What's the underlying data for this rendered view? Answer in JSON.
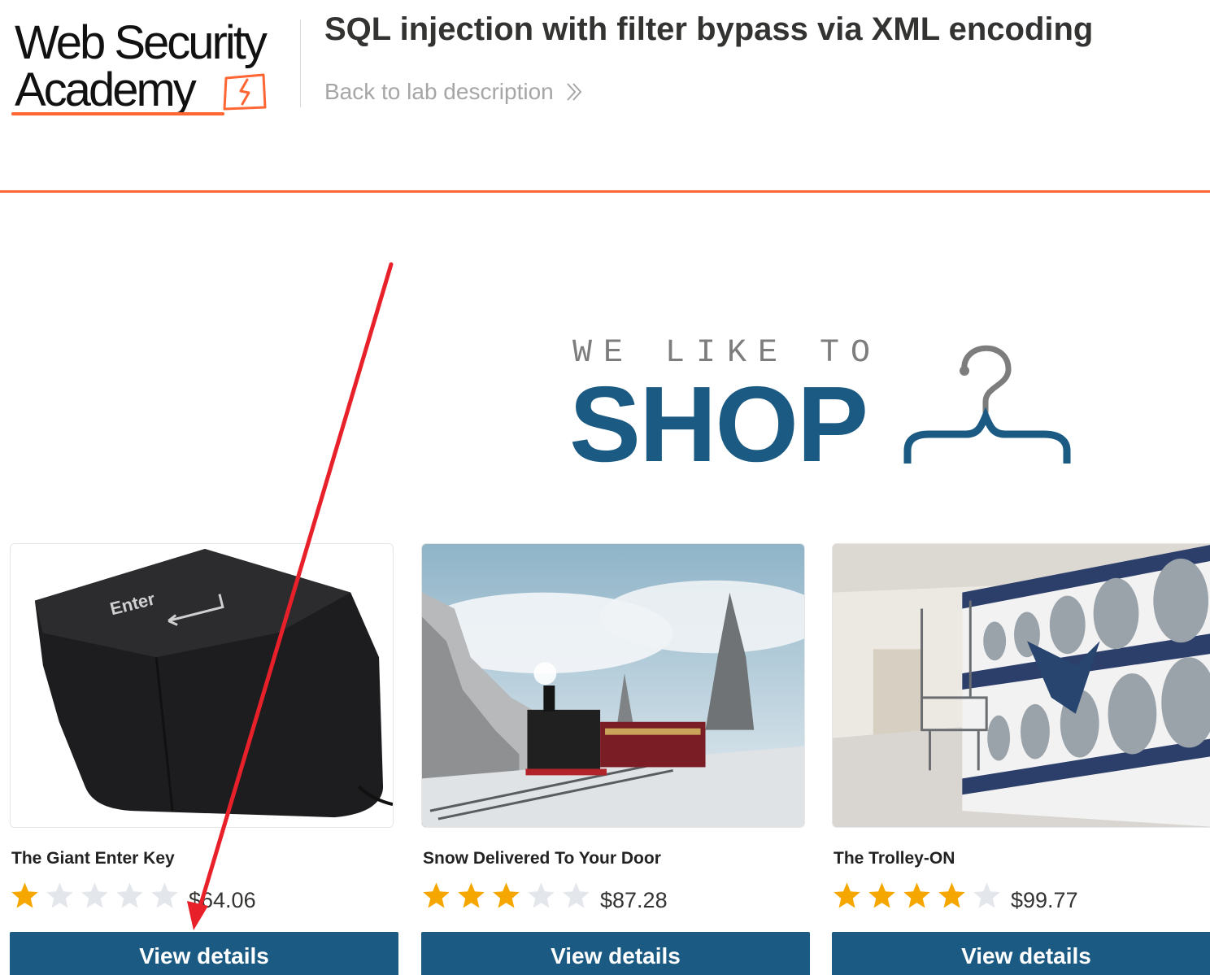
{
  "header": {
    "logo_line1": "Web Security",
    "logo_line2": "Academy",
    "lab_title": "SQL injection with filter bypass via XML encoding",
    "back_link": "Back to lab description",
    "accent_color": "#ff6633"
  },
  "banner": {
    "tagline": "WE LIKE TO",
    "headline": "SHOP",
    "brand_color": "#1b5a82",
    "icon": "hanger-icon"
  },
  "products": [
    {
      "name": "The Giant Enter Key",
      "rating": 1,
      "max_rating": 5,
      "price": "$64.06",
      "button": "View details",
      "image": "giant-enter-key-image"
    },
    {
      "name": "Snow Delivered To Your Door",
      "rating": 3,
      "max_rating": 5,
      "price": "$87.28",
      "button": "View details",
      "image": "snow-train-image"
    },
    {
      "name": "The Trolley-ON",
      "rating": 4,
      "max_rating": 5,
      "price": "$99.77",
      "button": "View details",
      "image": "laundromat-image"
    }
  ],
  "colors": {
    "star_filled": "#f5a700",
    "star_empty": "#e3e6ea",
    "button_bg": "#1b5a82",
    "annotation_arrow": "#e8202a"
  }
}
